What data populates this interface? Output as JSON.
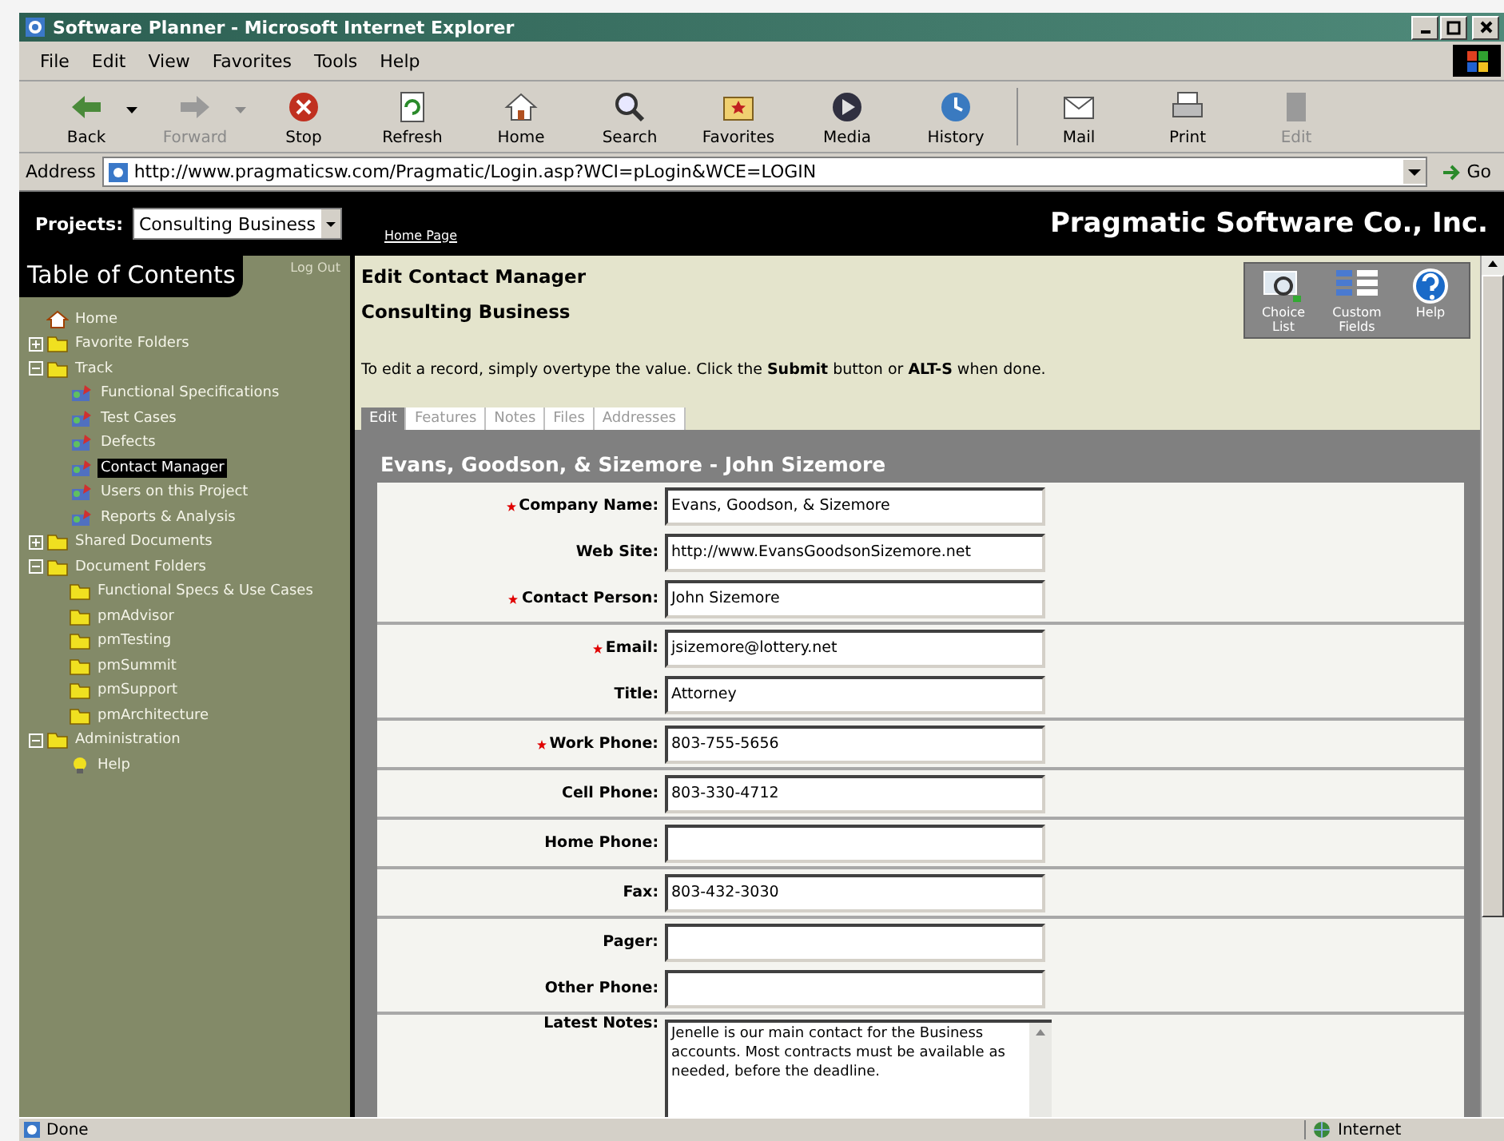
{
  "window": {
    "title": "Software Planner - Microsoft Internet Explorer"
  },
  "menu": [
    "File",
    "Edit",
    "View",
    "Favorites",
    "Tools",
    "Help"
  ],
  "toolbar": [
    {
      "label": "Back",
      "disabled": false
    },
    {
      "label": "Forward",
      "disabled": true
    },
    {
      "label": "Stop",
      "disabled": false
    },
    {
      "label": "Refresh",
      "disabled": false
    },
    {
      "label": "Home",
      "disabled": false
    },
    {
      "label": "Search",
      "disabled": false
    },
    {
      "label": "Favorites",
      "disabled": false
    },
    {
      "label": "Media",
      "disabled": false
    },
    {
      "label": "History",
      "disabled": false
    },
    {
      "label": "Mail",
      "disabled": false
    },
    {
      "label": "Print",
      "disabled": false
    },
    {
      "label": "Edit",
      "disabled": true
    }
  ],
  "address": {
    "label": "Address",
    "url": "http://www.pragmaticsw.com/Pragmatic/Login.asp?WCI=pLogin&WCE=LOGIN",
    "go": "Go"
  },
  "header": {
    "projects_label": "Projects:",
    "project": "Consulting Business",
    "link": "Home Page",
    "company": "Pragmatic Software Co., Inc."
  },
  "sidebar": {
    "title": "Table of Contents",
    "logout": "Log Out",
    "tree": [
      {
        "label": "Home",
        "kind": "home",
        "selected": false
      },
      {
        "label": "Favorite Folders",
        "kind": "folder",
        "expanded": false,
        "selected": false
      },
      {
        "label": "Track",
        "kind": "folder",
        "expanded": true,
        "selected": false,
        "children": [
          {
            "label": "Functional Specifications",
            "kind": "item",
            "selected": false
          },
          {
            "label": "Test Cases",
            "kind": "item",
            "selected": false
          },
          {
            "label": "Defects",
            "kind": "item",
            "selected": false
          },
          {
            "label": "Contact Manager",
            "kind": "item",
            "selected": true
          },
          {
            "label": "Users on this Project",
            "kind": "item",
            "selected": false
          },
          {
            "label": "Reports & Analysis",
            "kind": "item",
            "selected": false
          }
        ]
      },
      {
        "label": "Shared Documents",
        "kind": "folder",
        "expanded": false,
        "selected": false
      },
      {
        "label": "Document Folders",
        "kind": "folder",
        "expanded": true,
        "selected": false,
        "children": [
          {
            "label": "Functional Specs & Use Cases",
            "kind": "folder",
            "selected": false
          },
          {
            "label": "pmAdvisor",
            "kind": "folder",
            "selected": false
          },
          {
            "label": "pmTesting",
            "kind": "folder",
            "selected": false
          },
          {
            "label": "pmSummit",
            "kind": "folder",
            "selected": false
          },
          {
            "label": "pmSupport",
            "kind": "folder",
            "selected": false
          },
          {
            "label": "pmArchitecture",
            "kind": "folder",
            "selected": false
          }
        ]
      },
      {
        "label": "Administration",
        "kind": "folder",
        "expanded": true,
        "selected": false,
        "children": [
          {
            "label": "Help",
            "kind": "help",
            "selected": false
          }
        ]
      }
    ]
  },
  "content": {
    "title": "Edit Contact Manager",
    "subtitle": "Consulting Business",
    "actions": [
      "Choice List",
      "Custom Fields",
      "Help"
    ],
    "instructions": "To edit a record, simply overtype the value. Click the **Submit** button or **ALT-S** when done.",
    "tabs": [
      {
        "label": "Edit",
        "selected": true
      },
      {
        "label": "Features",
        "selected": false
      },
      {
        "label": "Notes",
        "selected": false
      },
      {
        "label": "Files",
        "selected": false
      },
      {
        "label": "Addresses",
        "selected": false
      }
    ],
    "record": "Evans, Goodson, & Sizemore - John Sizemore",
    "groups": [
      [
        {
          "label": "Company Name:",
          "required": true,
          "value": "Evans, Goodson, & Sizemore"
        },
        {
          "label": "Web Site:",
          "required": false,
          "value": "http://www.EvansGoodsonSizemore.net"
        },
        {
          "label": "Contact Person:",
          "required": true,
          "value": "John Sizemore"
        }
      ],
      [
        {
          "label": "Email:",
          "required": true,
          "value": "jsizemore@lottery.net"
        },
        {
          "label": "Title:",
          "required": false,
          "value": "Attorney"
        }
      ],
      [
        {
          "label": "Work Phone:",
          "required": true,
          "value": "803-755-5656"
        }
      ],
      [
        {
          "label": "Cell Phone:",
          "required": false,
          "value": "803-330-4712"
        }
      ],
      [
        {
          "label": "Home Phone:",
          "required": false
        }
      ],
      [
        {
          "label": "Fax:",
          "required": false,
          "value": "803-432-3030"
        }
      ],
      [
        {
          "label": "Pager:",
          "required": false
        },
        {
          "label": "Other Phone:",
          "required": false
        }
      ],
      [
        {
          "label": "Latest Notes:",
          "required": false,
          "kind": "notes",
          "value": "Jenelle is our main contact for the Business accounts. Most contracts must be available as needed, before the deadline."
        }
      ]
    ]
  },
  "status_bar": {
    "text": "Done",
    "zone": "Internet"
  }
}
